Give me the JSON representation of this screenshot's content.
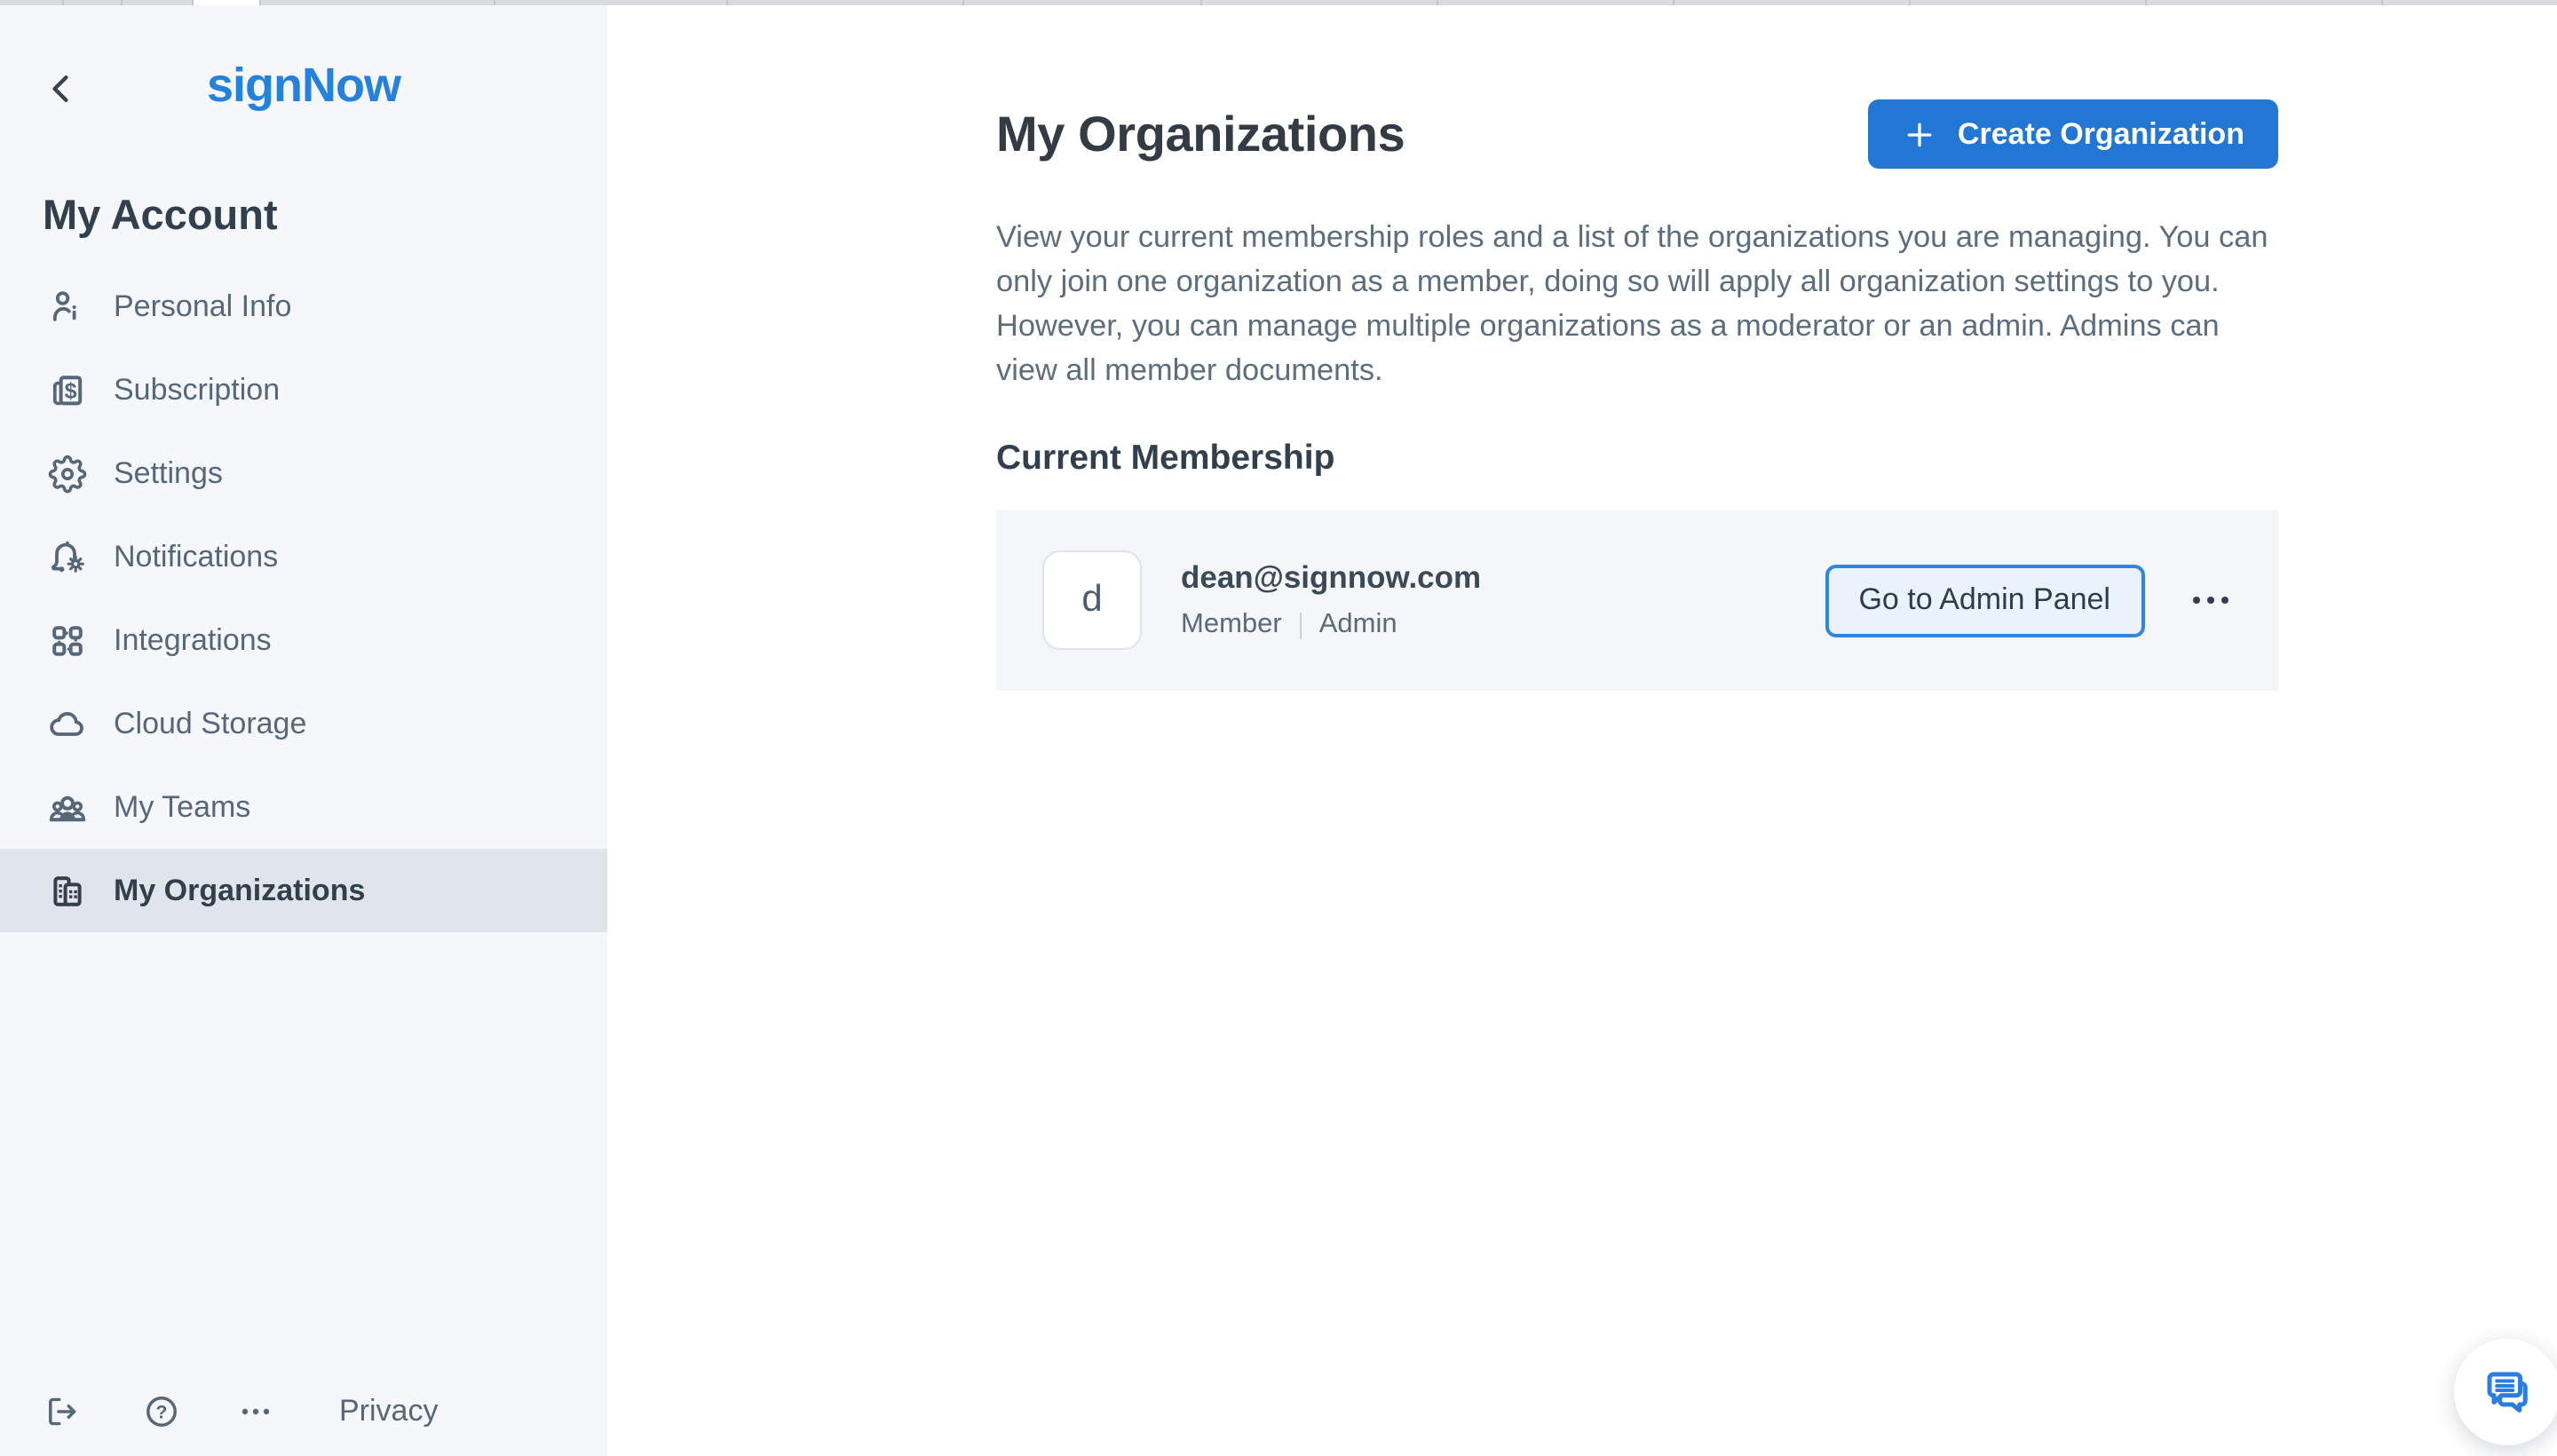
{
  "colors": {
    "accent": "#2277d4",
    "logo_blue": "#2481dd",
    "sidebar_bg": "#f5f7fa",
    "selected_bg": "#dfe5eb",
    "card_bg": "#f4f6f8",
    "admin_btn_bg": "#eaf3fc",
    "admin_btn_border": "#2f86dc",
    "text_dark": "#323f4c",
    "text_menu": "#56677a",
    "text_body": "#5c6d7e",
    "chat_blue": "#2b7de0"
  },
  "sidebar": {
    "logo": "signNow",
    "section_title": "My Account",
    "items": [
      {
        "label": "Personal Info",
        "icon": "person-info-icon",
        "selected": false
      },
      {
        "label": "Subscription",
        "icon": "subscription-icon",
        "selected": false
      },
      {
        "label": "Settings",
        "icon": "settings-gear-icon",
        "selected": false
      },
      {
        "label": "Notifications",
        "icon": "notification-bell-icon",
        "selected": false
      },
      {
        "label": "Integrations",
        "icon": "integrations-icon",
        "selected": false
      },
      {
        "label": "Cloud Storage",
        "icon": "cloud-icon",
        "selected": false
      },
      {
        "label": "My Teams",
        "icon": "teams-icon",
        "selected": false
      },
      {
        "label": "My Organizations",
        "icon": "organizations-icon",
        "selected": true
      }
    ],
    "footer": {
      "privacy_label": "Privacy"
    }
  },
  "main": {
    "title": "My Organizations",
    "create_button_label": "Create Organization",
    "description": "View your current membership roles and a list of the organizations you are managing. You can only join one organization as a member, doing so will apply all organization settings to you. However, you can manage multiple organizations as a moderator or an admin. Admins can view all member documents.",
    "membership_heading": "Current Membership",
    "membership": {
      "avatar_initial": "d",
      "email": "dean@signnow.com",
      "roles": [
        "Member",
        "Admin"
      ],
      "admin_button_label": "Go to Admin Panel"
    }
  }
}
